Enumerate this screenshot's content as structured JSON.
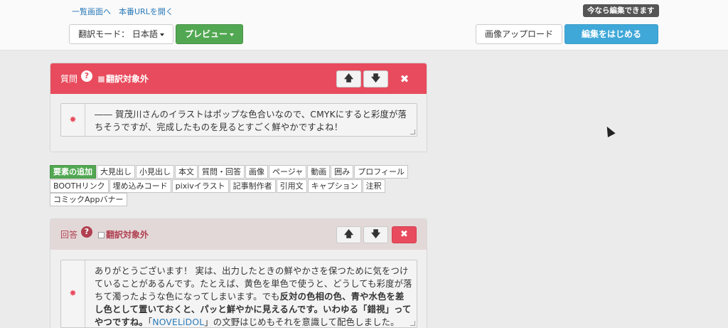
{
  "header": {
    "links": [
      "一覧画面へ",
      "本番URLを開く"
    ],
    "badge": "今なら編集できます",
    "mode_label": "翻訳モード： 日本語",
    "preview_label": "プレビュー",
    "image_upload_label": "画像アップロード",
    "start_edit_label": "編集をはじめる"
  },
  "question": {
    "title": "質問",
    "help": "?",
    "exclude_label": "翻訳対象外",
    "up": "🡅",
    "down": "🡇",
    "close": "✖",
    "required": "✸",
    "text": "―― 賀茂川さんのイラストはポップな色合いなので、CMYKにすると彩度が落ちそうですが、完成したものを見るとすごく鮮やかですよね！"
  },
  "toolbar": {
    "row1": [
      "要素の追加",
      "大見出し",
      "小見出し",
      "本文",
      "質問・回答",
      "画像",
      "ページャ",
      "動画",
      "囲み",
      "プロフィール"
    ],
    "row2": [
      "BOOTHリンク",
      "埋め込みコード",
      "pixivイラスト",
      "記事制作者",
      "引用文",
      "キャプション",
      "注釈"
    ],
    "row3": [
      "コミックAppバナー"
    ]
  },
  "answer": {
    "title": "回答",
    "help": "?",
    "exclude_label": "翻訳対象外",
    "up": "🡅",
    "down": "🡇",
    "close": "✖",
    "required": "✸",
    "text_1": "ありがとうございます！ 実は、出力したときの鮮やかさを保つために気をつけていることがあるんです。たとえば、黄色を単色で使うと、どうしても彩度が落ちて濁ったような色になってしまいます。でも",
    "text_bold": "反対の色相の色、青や水色を差し色として置いておくと、パッと鮮やかに見えるんです。いわゆる「錯視」ってやつですね。",
    "text_2": "「",
    "text_link": "NOVELiDOL",
    "text_3": "」の文野はじめもそれを意識して配色しました。"
  },
  "colors": {
    "question_header": "#e84b5d",
    "answer_header": "#e3d8d8",
    "preview_green": "#52a852",
    "start_blue": "#3fa8d8"
  }
}
